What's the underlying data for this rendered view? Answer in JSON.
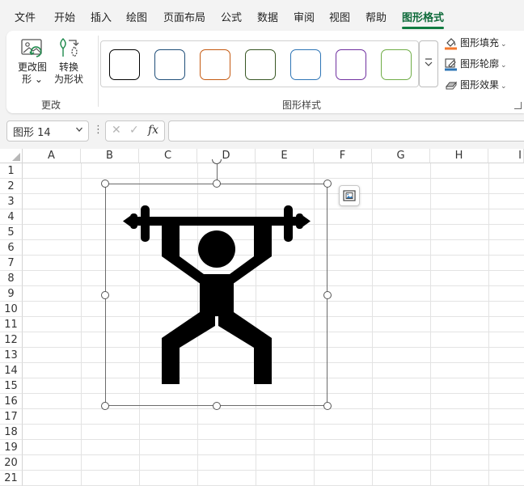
{
  "menu": {
    "tabs": [
      {
        "label": "文件",
        "active": false
      },
      {
        "label": "开始",
        "active": false
      },
      {
        "label": "插入",
        "active": false
      },
      {
        "label": "绘图",
        "active": false
      },
      {
        "label": "页面布局",
        "active": false
      },
      {
        "label": "公式",
        "active": false
      },
      {
        "label": "数据",
        "active": false
      },
      {
        "label": "审阅",
        "active": false
      },
      {
        "label": "视图",
        "active": false
      },
      {
        "label": "帮助",
        "active": false
      },
      {
        "label": "图形格式",
        "active": true
      }
    ]
  },
  "ribbon": {
    "change_group": {
      "change_shape": {
        "line1": "更改图",
        "line2": "形 ⌄"
      },
      "convert_shape": {
        "line1": "转换",
        "line2": "为形状"
      },
      "label": "更改"
    },
    "styles_group": {
      "label": "图形样式",
      "swatch_colors": [
        "#000000",
        "#1f4e79",
        "#c55a11",
        "#375623",
        "#2e75b6",
        "#7030a0",
        "#70ad47"
      ],
      "more_icon": "gallery-more-icon"
    },
    "fill": {
      "label": "图形填充",
      "color": "#f4782d"
    },
    "outline": {
      "label": "图形轮廓",
      "color": "#2e75b6"
    },
    "effects": {
      "label": "图形效果"
    }
  },
  "formula_bar": {
    "name_box": "图形 14",
    "cancel_glyph": "✕",
    "enter_glyph": "✓",
    "fx_label": "fx",
    "formula": ""
  },
  "grid": {
    "columns": [
      "A",
      "B",
      "C",
      "D",
      "E",
      "F",
      "G",
      "H",
      "I"
    ],
    "rows": [
      "1",
      "2",
      "3",
      "4",
      "5",
      "6",
      "7",
      "8",
      "9",
      "10",
      "11",
      "12",
      "13",
      "14",
      "15",
      "16",
      "17",
      "18",
      "19",
      "20",
      "21"
    ]
  },
  "shape": {
    "icon": "weightlifting-icon",
    "color": "#000000",
    "layout_options_icon": "layout-options-icon"
  }
}
